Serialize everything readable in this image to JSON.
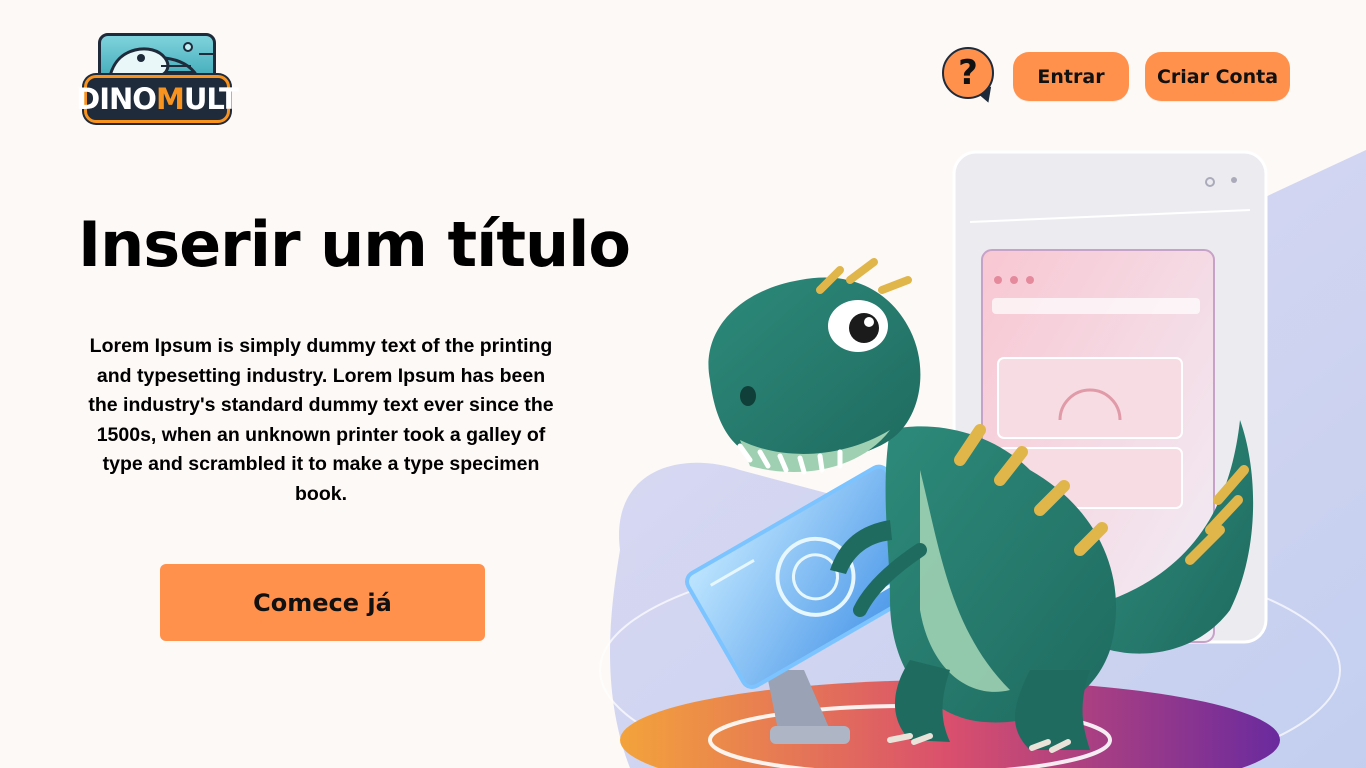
{
  "brand": {
    "logo_prefix": "DINO",
    "logo_accent": "M",
    "logo_suffix": "ULT",
    "accent_color": "#f7931e"
  },
  "header": {
    "help_icon": "help-question-icon",
    "help_glyph": "?",
    "login_label": "Entrar",
    "signup_label": "Criar Conta",
    "button_color": "#ff914d"
  },
  "hero": {
    "title": "Inserir um título",
    "body": "Lorem Ipsum is simply dummy text of the printing and typesetting industry. Lorem Ipsum has been the industry's standard dummy text ever since the 1500s, when an unknown printer took a galley of type and scrambled it to make a type specimen book.",
    "cta_label": "Comece já"
  },
  "illustration": {
    "subject": "dinosaur-using-tablet-illustration"
  }
}
